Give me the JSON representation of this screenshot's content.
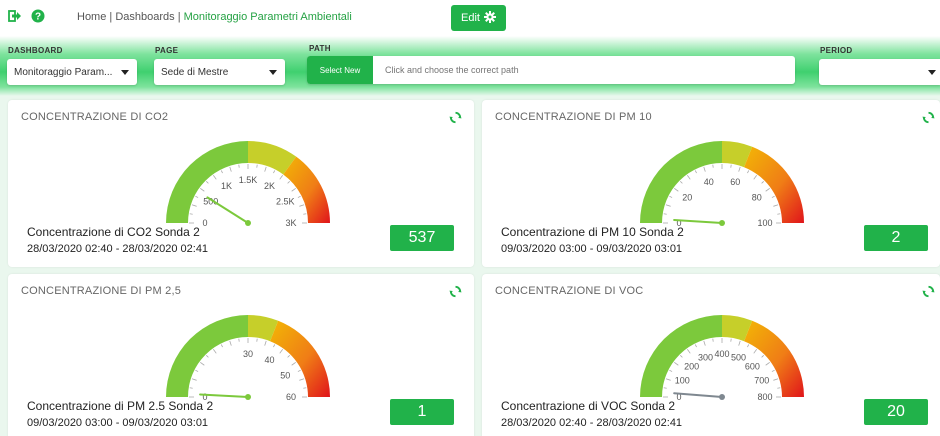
{
  "header": {
    "breadcrumb_home": "Home",
    "breadcrumb_sep1": " | ",
    "breadcrumb_dashboards": "Dashboards",
    "breadcrumb_sep2": " | ",
    "breadcrumb_current": "Monitoraggio Parametri Ambientali",
    "edit_label": "Edit",
    "icons": [
      "logout-icon",
      "help-icon",
      "gear-icon"
    ]
  },
  "filters": {
    "dashboard_label": "DASHBOARD",
    "dashboard_value": "Monitoraggio Param...",
    "page_label": "PAGE",
    "page_value": "Sede di Mestre",
    "path_label": "PATH",
    "path_button": "Select New",
    "path_placeholder": "Click and choose the correct path",
    "period_label": "PERIOD",
    "period_value": ""
  },
  "colors": {
    "accent": "#21b24a",
    "breadcrumb_active": "#25a244",
    "gauge_green": "#7cc93c",
    "gauge_yellow": "#f2b705",
    "gauge_orange": "#f07d16",
    "gauge_red": "#e0141b"
  },
  "cards": [
    {
      "title": "CONCENTRAZIONE DI CO2",
      "sensor": "Concentrazione di CO2 Sonda 2",
      "period": "28/03/2020 02:40 - 28/03/2020 02:41",
      "value_text": "537",
      "gauge": {
        "min": 0,
        "max": 3000,
        "value": 537,
        "green_to": 0.5,
        "yellow_to": 0.7,
        "ticks": [
          {
            "v": 0,
            "label": "0"
          },
          {
            "v": 500,
            "label": "500"
          },
          {
            "v": 1000,
            "label": "1K"
          },
          {
            "v": 1500,
            "label": "1.5K"
          },
          {
            "v": 2000,
            "label": "2K"
          },
          {
            "v": 2500,
            "label": "2.5K"
          },
          {
            "v": 3000,
            "label": "3K"
          }
        ],
        "needle": "#7cc93c"
      }
    },
    {
      "title": "CONCENTRAZIONE DI PM 10",
      "sensor": "Concentrazione di PM 10 Sonda 2",
      "period": "09/03/2020 03:00 - 09/03/2020 03:01",
      "value_text": "2",
      "gauge": {
        "min": 0,
        "max": 100,
        "value": 2,
        "green_to": 0.5,
        "yellow_to": 0.62,
        "ticks": [
          {
            "v": 0,
            "label": "0"
          },
          {
            "v": 20,
            "label": "20"
          },
          {
            "v": 40,
            "label": "40"
          },
          {
            "v": 60,
            "label": "60"
          },
          {
            "v": 80,
            "label": "80"
          },
          {
            "v": 100,
            "label": "100"
          }
        ],
        "needle": "#7cc93c"
      }
    },
    {
      "title": "CONCENTRAZIONE DI PM 2,5",
      "sensor": "Concentrazione di PM 2.5 Sonda 2",
      "period": "09/03/2020 03:00 - 09/03/2020 03:01",
      "value_text": "1",
      "gauge": {
        "min": 0,
        "max": 60,
        "value": 1,
        "green_to": 0.5,
        "yellow_to": 0.62,
        "ticks": [
          {
            "v": 0,
            "label": "0"
          },
          {
            "v": 30,
            "label": "30"
          },
          {
            "v": 40,
            "label": "40"
          },
          {
            "v": 50,
            "label": "50"
          },
          {
            "v": 60,
            "label": "60"
          }
        ],
        "needle": "#7cc93c"
      }
    },
    {
      "title": "CONCENTRAZIONE DI VOC",
      "sensor": "Concentrazione di VOC Sonda 2",
      "period": "28/03/2020 02:40 - 28/03/2020 02:41",
      "value_text": "20",
      "gauge": {
        "min": 0,
        "max": 800,
        "value": 20,
        "green_to": 0.5,
        "yellow_to": 0.62,
        "ticks": [
          {
            "v": 0,
            "label": "0"
          },
          {
            "v": 100,
            "label": "100"
          },
          {
            "v": 200,
            "label": "200"
          },
          {
            "v": 300,
            "label": "300"
          },
          {
            "v": 400,
            "label": "400"
          },
          {
            "v": 500,
            "label": "500"
          },
          {
            "v": 600,
            "label": "600"
          },
          {
            "v": 700,
            "label": "700"
          },
          {
            "v": 800,
            "label": "800"
          }
        ],
        "needle": "#7f8890"
      }
    }
  ]
}
